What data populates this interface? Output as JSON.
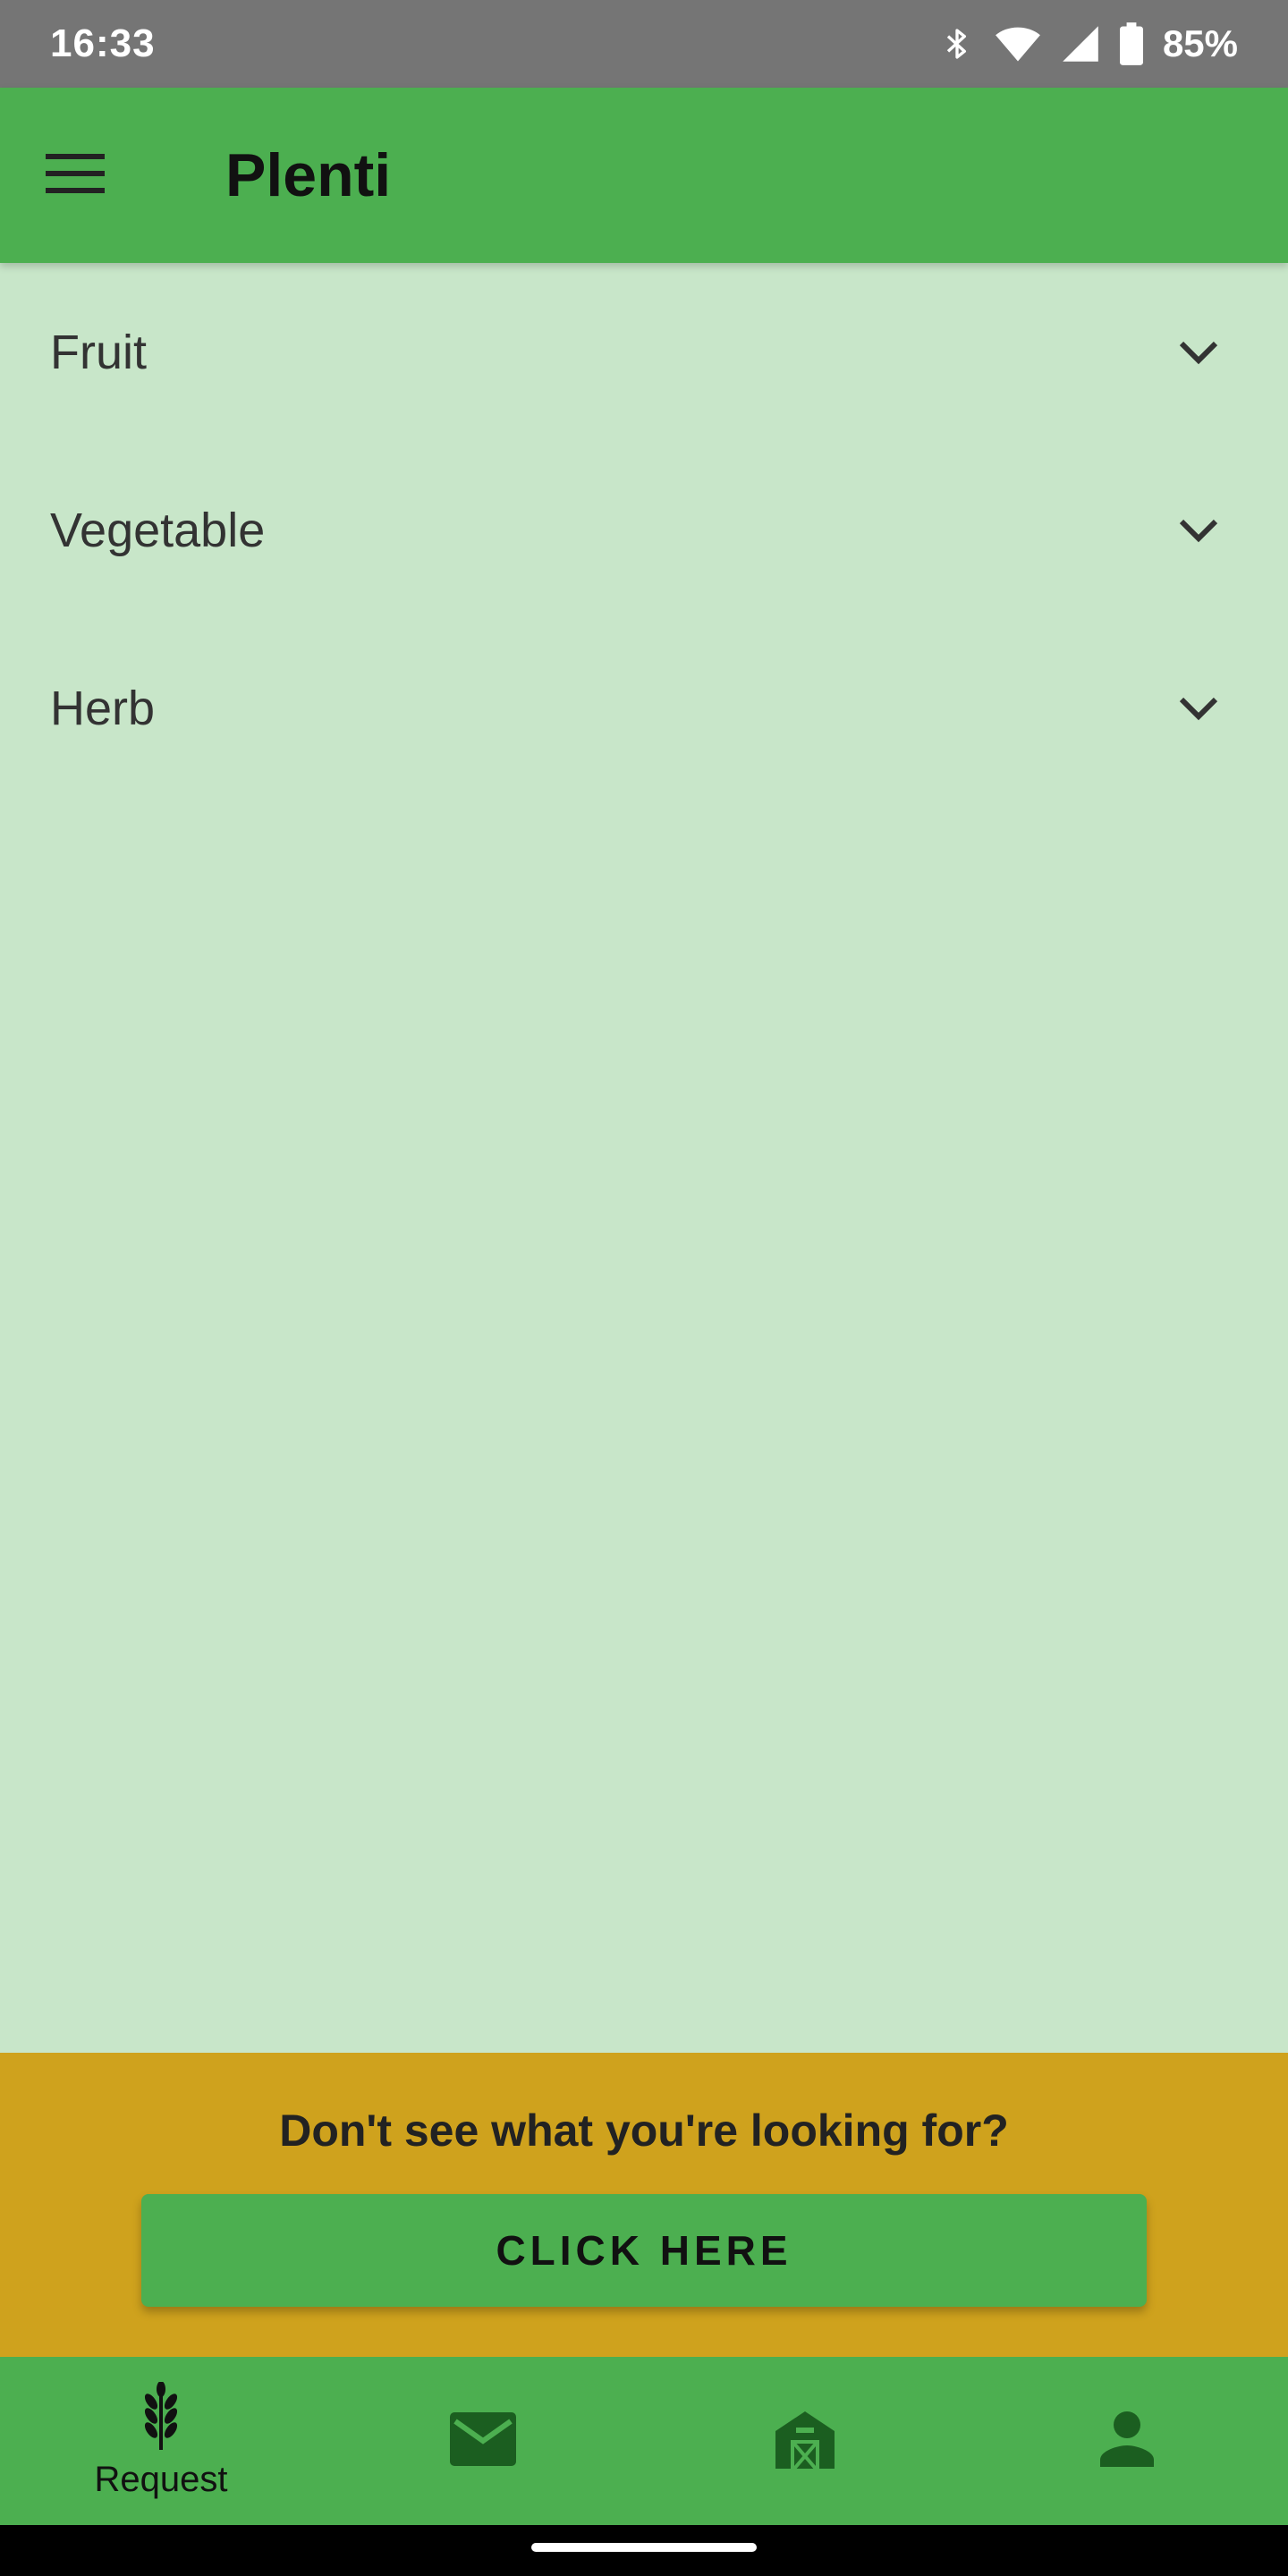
{
  "status_bar": {
    "time": "16:33",
    "battery_percent": "85%",
    "icons": [
      "bluetooth-icon",
      "wifi-icon",
      "cell-signal-icon",
      "battery-icon"
    ]
  },
  "app_bar": {
    "title": "Plenti",
    "menu_icon": "hamburger-menu-icon"
  },
  "categories": [
    {
      "label": "Fruit",
      "icon": "chevron-down-icon"
    },
    {
      "label": "Vegetable",
      "icon": "chevron-down-icon"
    },
    {
      "label": "Herb",
      "icon": "chevron-down-icon"
    }
  ],
  "prompt": {
    "text": "Don't see what you're looking for?",
    "button_label": "CLICK HERE"
  },
  "bottom_nav": [
    {
      "label": "Request",
      "icon": "wheat-icon",
      "active": true
    },
    {
      "label": "",
      "icon": "mail-icon",
      "active": false
    },
    {
      "label": "",
      "icon": "barn-icon",
      "active": false
    },
    {
      "label": "",
      "icon": "person-icon",
      "active": false
    }
  ],
  "colors": {
    "status_bar": "#757575",
    "primary": "#4caf50",
    "background": "#c8e6c9",
    "prompt_background": "#cfa21d",
    "inactive_icon": "#1b5e20"
  }
}
